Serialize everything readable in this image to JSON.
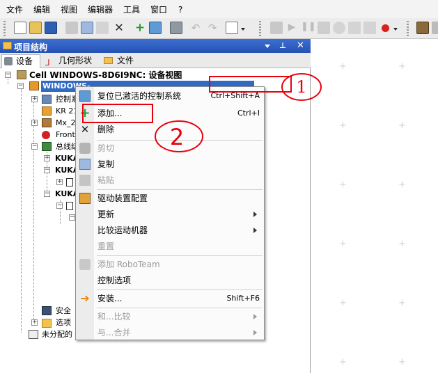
{
  "menubar": {
    "items": [
      {
        "label": "文件"
      },
      {
        "label": "编辑"
      },
      {
        "label": "视图"
      },
      {
        "label": "编辑器"
      },
      {
        "label": "工具"
      },
      {
        "label": "窗口"
      },
      {
        "label": "?"
      }
    ]
  },
  "panel": {
    "title": "项目结构",
    "tabs": [
      {
        "label": "设备"
      },
      {
        "label": "几何形状"
      },
      {
        "label": "文件"
      }
    ]
  },
  "tree": {
    "root": "Cell WINDOWS-8D6I9NC: 设备视图",
    "controller": "WINDOWS-",
    "items": [
      {
        "label": "控制系"
      },
      {
        "label": "KR 21"
      },
      {
        "label": "Mx_20"
      },
      {
        "label": "Front"
      },
      {
        "label": "总线结"
      },
      {
        "label": "KUKA"
      },
      {
        "label": "KUKA"
      },
      {
        "label": "KUKA"
      },
      {
        "label": "安全"
      },
      {
        "label": "选项"
      },
      {
        "label": "未分配的"
      }
    ]
  },
  "context_menu": {
    "items": [
      {
        "label": "复位已激活的控制系统",
        "shortcut": "Ctrl+Shift+A",
        "enabled": true
      },
      {
        "label": "添加...",
        "shortcut": "Ctrl+I",
        "enabled": true
      },
      {
        "label": "删除",
        "shortcut": "",
        "enabled": true
      },
      {
        "label": "剪切",
        "shortcut": "",
        "enabled": false
      },
      {
        "label": "复制",
        "shortcut": "",
        "enabled": true
      },
      {
        "label": "粘贴",
        "shortcut": "",
        "enabled": false
      },
      {
        "label": "驱动装置配置",
        "shortcut": "",
        "enabled": true
      },
      {
        "label": "更新",
        "shortcut": "",
        "enabled": true,
        "submenu": true
      },
      {
        "label": "比较运动机器",
        "shortcut": "",
        "enabled": true,
        "submenu": true
      },
      {
        "label": "重置",
        "shortcut": "",
        "enabled": false
      },
      {
        "label": "添加 RoboTeam",
        "shortcut": "",
        "enabled": false
      },
      {
        "label": "控制选项",
        "shortcut": "",
        "enabled": true
      },
      {
        "label": "安装...",
        "shortcut": "Shift+F6",
        "enabled": true
      },
      {
        "label": "和...比较",
        "shortcut": "",
        "enabled": false,
        "submenu": true
      },
      {
        "label": "与...合并",
        "shortcut": "",
        "enabled": false,
        "submenu": true
      }
    ]
  },
  "annotations": {
    "circle1": "1",
    "circle2": "2"
  },
  "colors": {
    "accent": "#2452b4",
    "annotation": "#e8000d"
  }
}
